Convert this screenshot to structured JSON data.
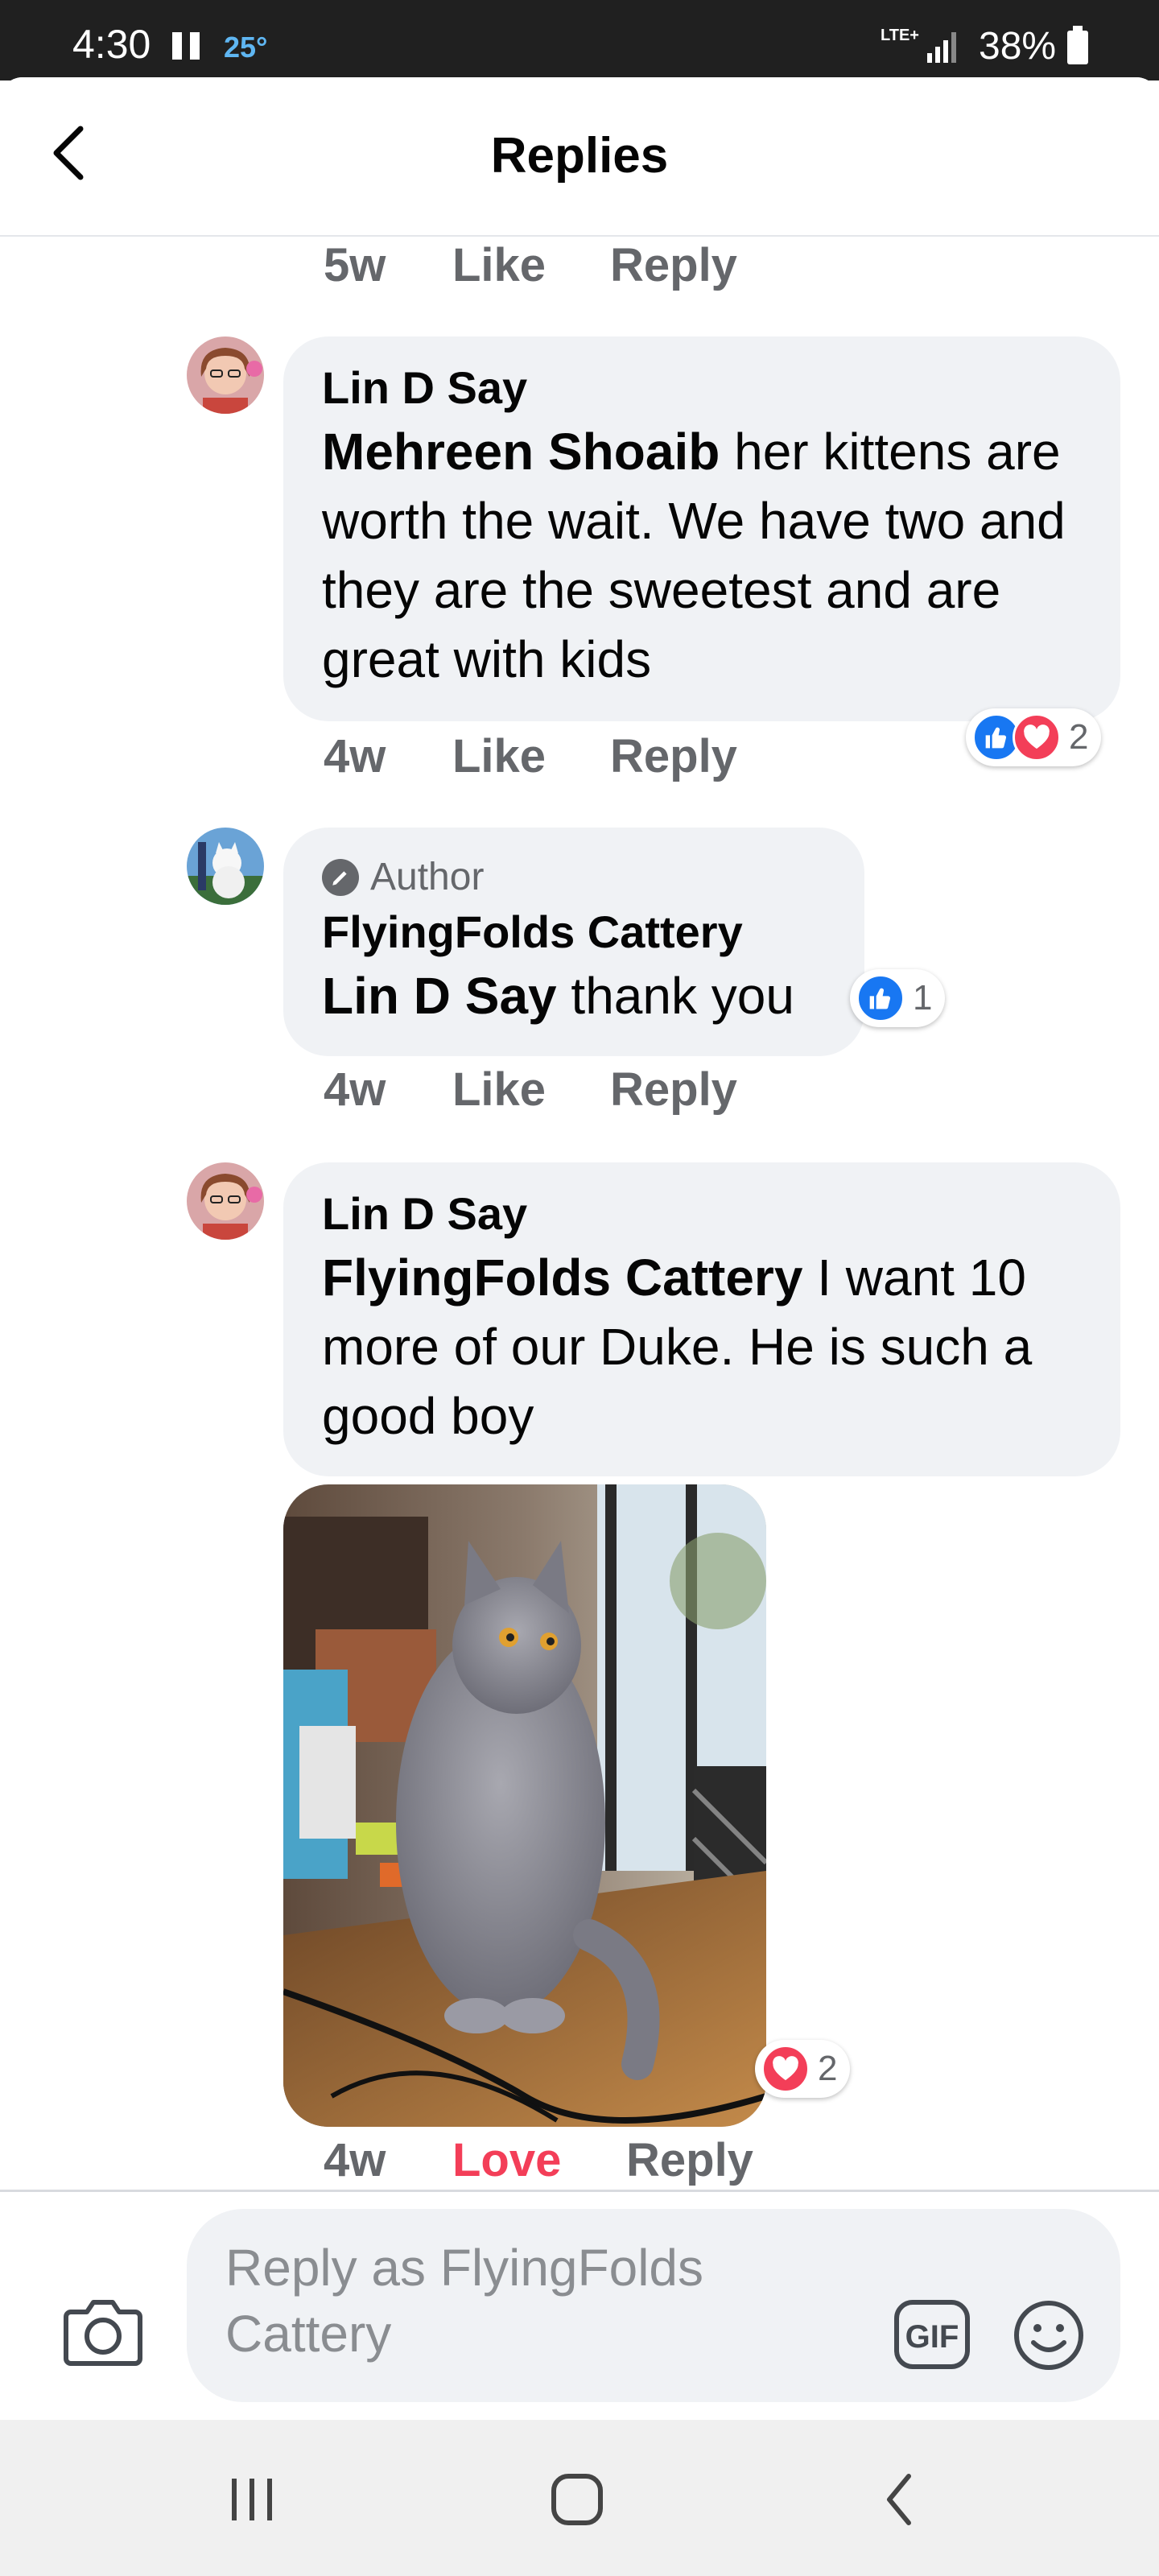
{
  "status_bar": {
    "time": "4:30",
    "temperature": "25°",
    "network": "LTE+",
    "battery": "38%"
  },
  "header": {
    "title": "Replies",
    "back_icon": "back-arrow-icon"
  },
  "top_actions": {
    "time": "5w",
    "like": "Like",
    "reply": "Reply"
  },
  "comments": [
    {
      "author": "Lin D Say",
      "mention": "Mehreen Shoaib",
      "text": " her kittens are worth the wait. We have two and they are the sweetest and are great with kids",
      "time": "4w",
      "like": "Like",
      "reply": "Reply",
      "reaction_count": "2"
    },
    {
      "badge": "Author",
      "author": "FlyingFolds Cattery",
      "mention": "Lin D Say",
      "text": " thank you",
      "time": "4w",
      "like": "Like",
      "reply": "Reply",
      "reaction_count": "1"
    },
    {
      "author": "Lin D Say",
      "mention": "FlyingFolds Cattery",
      "text": " I want 10 more of our Duke. He is such a good boy",
      "time": "4w",
      "like": "Love",
      "reply": "Reply",
      "reaction_count": "2"
    }
  ],
  "composer": {
    "placeholder": "Reply as FlyingFolds Cattery",
    "gif_label": "GIF"
  },
  "colors": {
    "love": "#f33e58",
    "like": "#1877f2",
    "bubble": "#f0f2f5",
    "meta": "#65676b"
  }
}
